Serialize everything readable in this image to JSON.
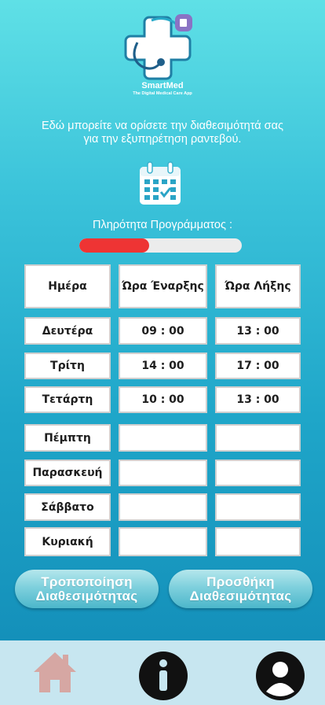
{
  "brand": {
    "name": "SmartMed",
    "tagline": "The Digital Medical Care App"
  },
  "intro_line1": "Εδώ μπορείτε να ορίσετε την διαθεσιμότητά σας",
  "intro_line2": "για την εξυπηρέτηση ραντεβού.",
  "progress": {
    "label": "Πληρότητα Προγράμματος :",
    "value": 0.43,
    "color": "#ee3434"
  },
  "table": {
    "headers": [
      "Ημέρα",
      "Ώρα Έναρξης",
      "Ώρα Λήξης"
    ],
    "rows": [
      {
        "day": "Δευτέρα",
        "start": "09 : 00",
        "end": "13 : 00"
      },
      {
        "day": "Τρίτη",
        "start": "14 : 00",
        "end": "17 : 00"
      },
      {
        "day": "Τετάρτη",
        "start": "10 : 00",
        "end": "13 : 00"
      },
      {
        "day": "Πέμπτη",
        "start": "",
        "end": ""
      },
      {
        "day": "Παρασκευή",
        "start": "",
        "end": ""
      },
      {
        "day": "Σάββατο",
        "start": "",
        "end": ""
      },
      {
        "day": "Κυριακή",
        "start": "",
        "end": ""
      }
    ]
  },
  "buttons": {
    "modify_line1": "Τροποποίηση",
    "modify_line2": "Διαθεσιμότητας",
    "add_line1": "Προσθήκη",
    "add_line2": "Διαθεσιμότητας"
  },
  "nav": {
    "home": "home-icon",
    "info": "info-icon",
    "profile": "user-icon"
  },
  "icons": {
    "calendar": "calendar-check-icon",
    "logo": "medical-cross-stethoscope-logo"
  }
}
